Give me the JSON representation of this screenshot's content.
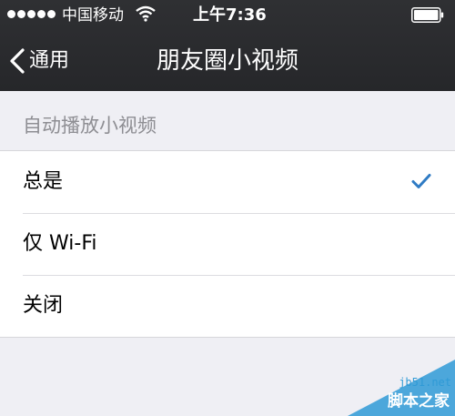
{
  "status_bar": {
    "carrier": "中国移动",
    "time": "上午7:36",
    "signal_icon": "signal-dots-icon",
    "wifi_icon": "wifi-icon",
    "battery_icon": "battery-icon"
  },
  "nav": {
    "back_label": "通用",
    "back_icon": "chevron-left-icon",
    "title": "朋友圈小视频"
  },
  "section": {
    "header": "自动播放小视频",
    "options": [
      {
        "label": "总是",
        "selected": true
      },
      {
        "label": "仅 Wi-Fi",
        "selected": false
      },
      {
        "label": "关闭",
        "selected": false
      }
    ]
  },
  "watermark": {
    "url": "jb51.net",
    "name": "脚本之家"
  },
  "colors": {
    "nav_background": "#2b2c2f",
    "page_background": "#efeff4",
    "accent": "#2f7bc4",
    "section_header": "#8e8e93"
  }
}
